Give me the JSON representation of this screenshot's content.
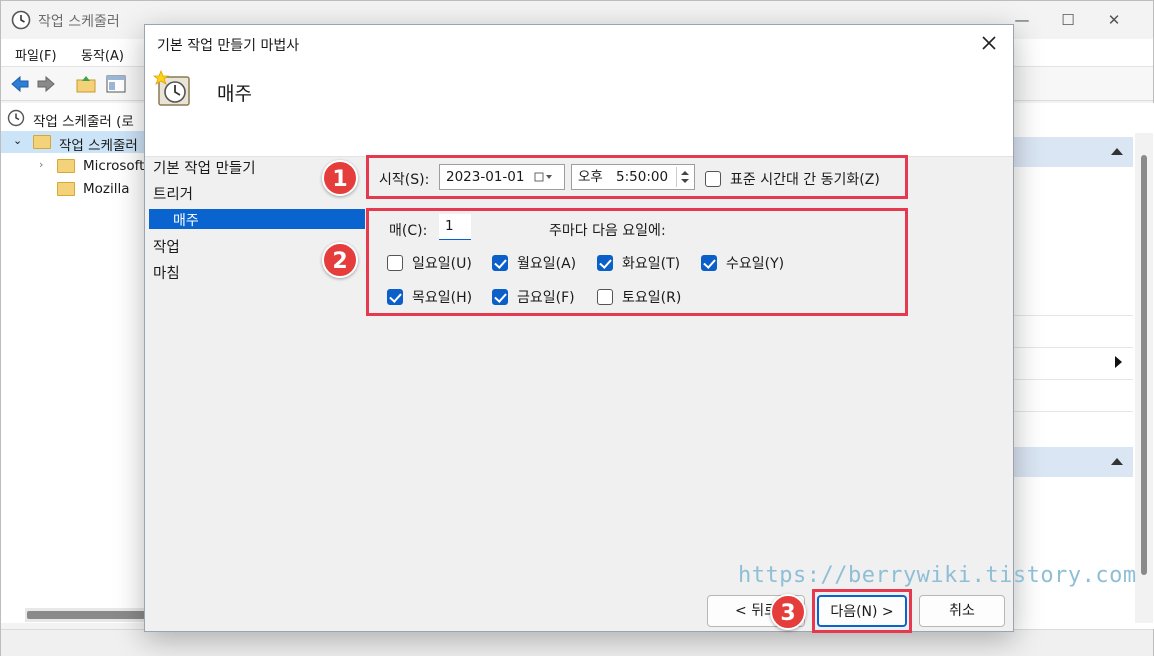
{
  "main_window": {
    "title": "작업 스케줄러",
    "menu": [
      "파일(F)",
      "동작(A)"
    ],
    "tree": [
      {
        "label": "작업 스케줄러 (로"
      },
      {
        "label": "작업 스케줄러"
      },
      {
        "label": "Microsoft"
      },
      {
        "label": "Mozilla"
      }
    ]
  },
  "dialog": {
    "title": "기본 작업 만들기 마법사",
    "header": "매주",
    "nav": {
      "items": [
        "기본 작업 만들기",
        "트리거",
        "작업",
        "마침"
      ],
      "selected": "매주"
    },
    "start": {
      "label": "시작(S):",
      "date": "2023-01-01",
      "ampm": "오후",
      "time": "5:50:00",
      "sync_label": "표준 시간대 간 동기화(Z)",
      "sync_checked": false
    },
    "recur": {
      "every_label": "매(C):",
      "every_value": "1",
      "weeks_text": "주마다 다음 요일에:"
    },
    "days": [
      {
        "label": "일요일(U)",
        "checked": false
      },
      {
        "label": "월요일(A)",
        "checked": true
      },
      {
        "label": "화요일(T)",
        "checked": true
      },
      {
        "label": "수요일(Y)",
        "checked": true
      },
      {
        "label": "목요일(H)",
        "checked": true
      },
      {
        "label": "금요일(F)",
        "checked": true
      },
      {
        "label": "토요일(R)",
        "checked": false
      }
    ],
    "buttons": {
      "back": "< 뒤로",
      "next": "다음(N) >",
      "cancel": "취소"
    }
  },
  "annotations": {
    "badge1": "1",
    "badge2": "2",
    "badge3": "3",
    "color": "#e53950"
  },
  "watermark": "https://berrywiki.tistory.com"
}
